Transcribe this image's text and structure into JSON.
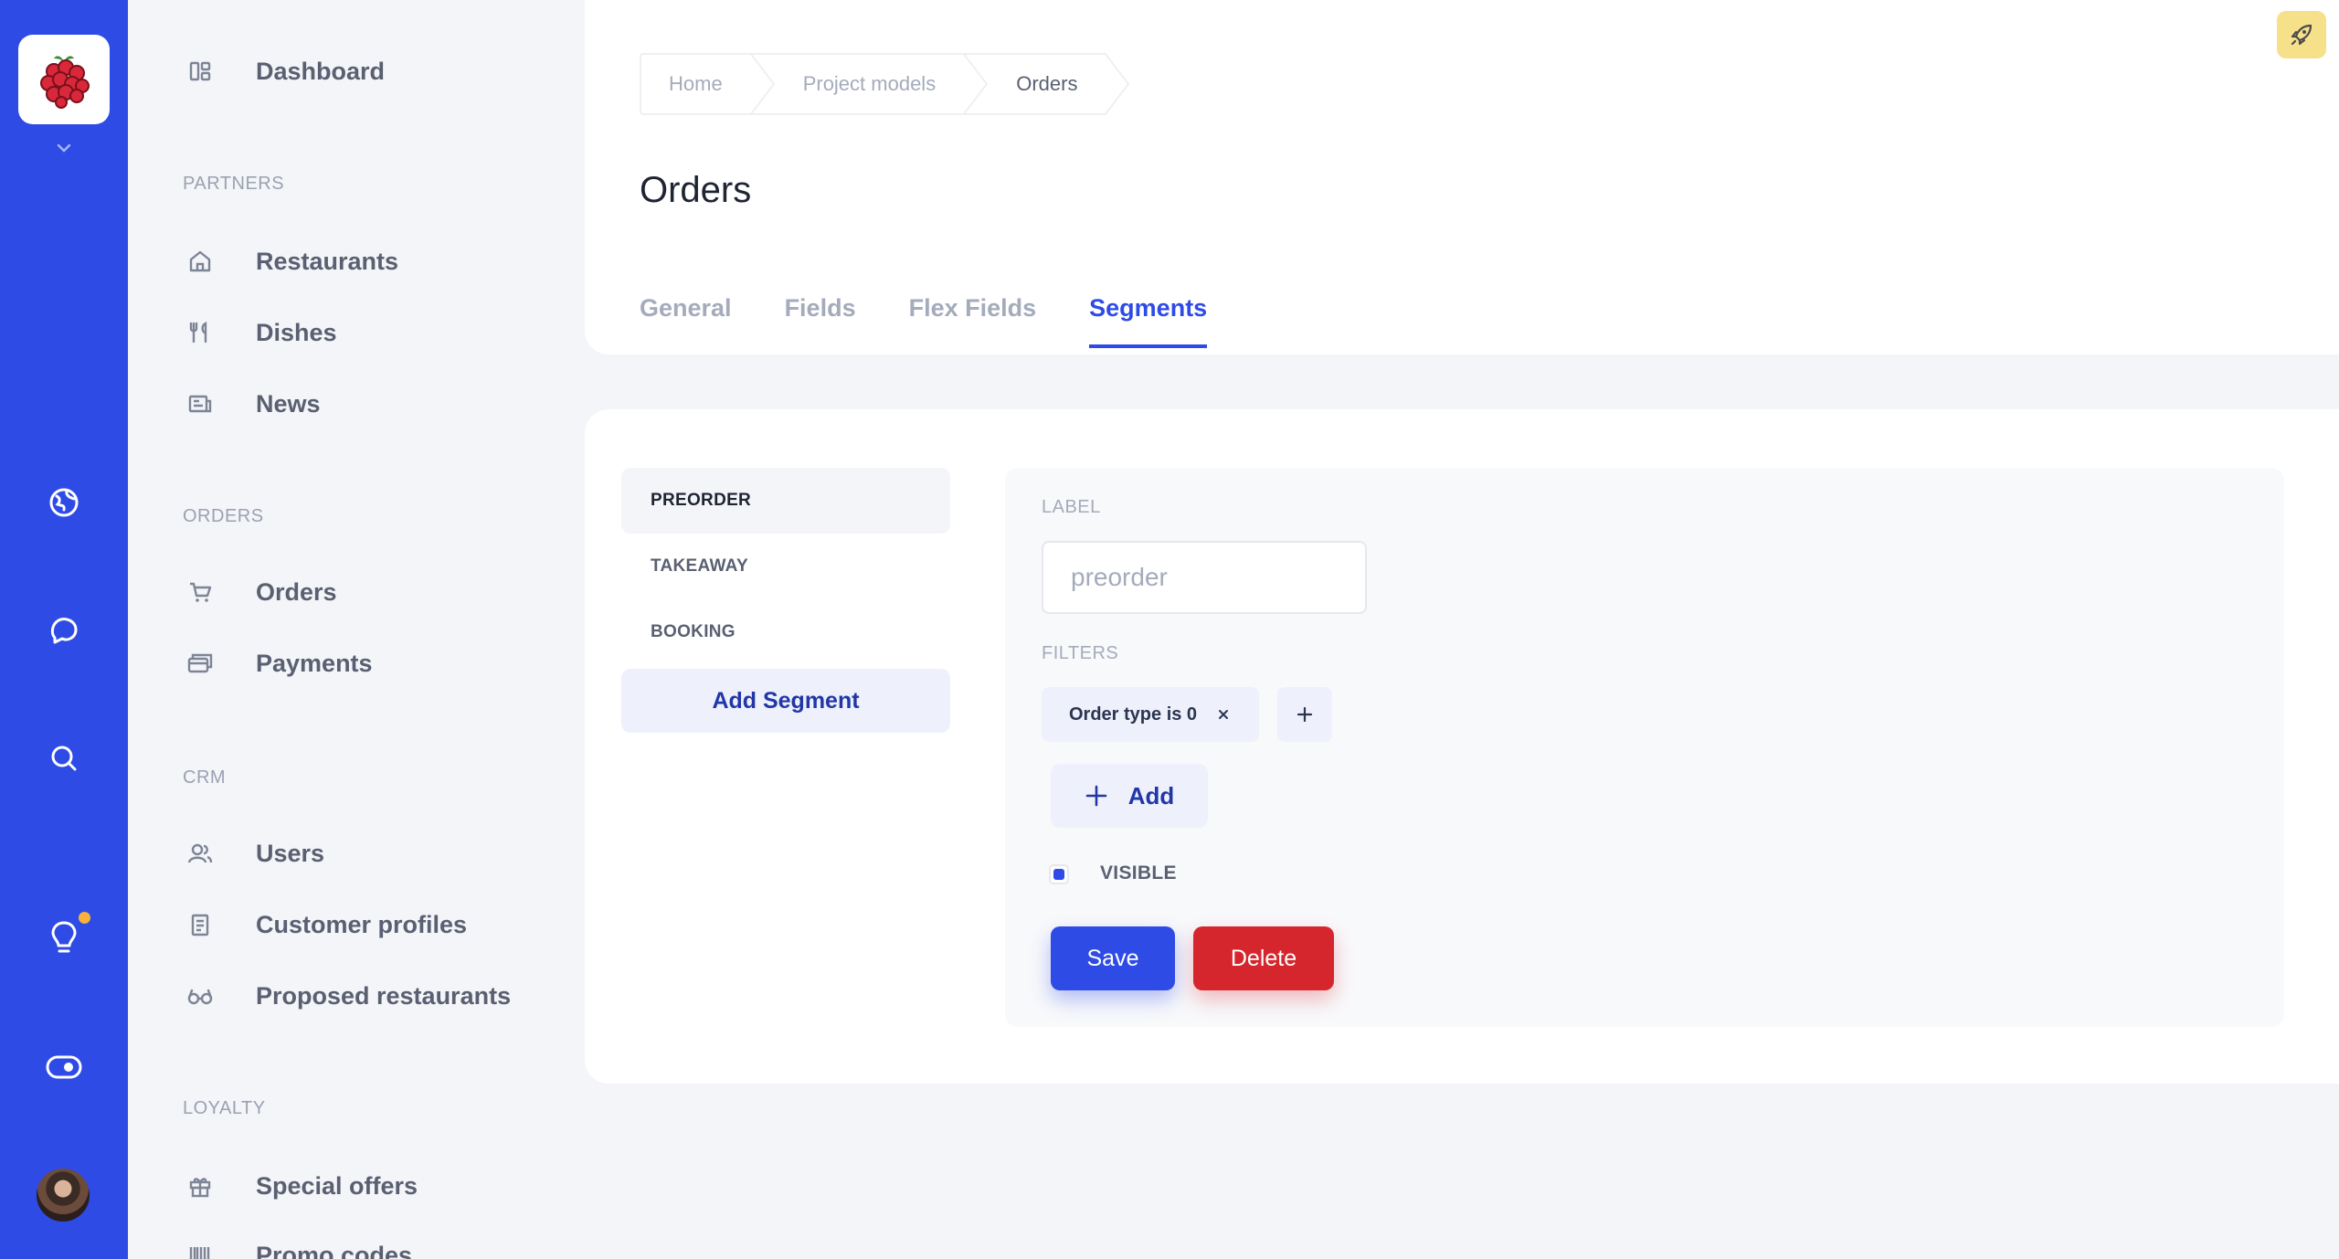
{
  "sidebar": {
    "sections": {
      "partners": "PARTNERS",
      "orders": "ORDERS",
      "crm": "CRM",
      "loyalty": "LOYALTY"
    },
    "items": {
      "dashboard": "Dashboard",
      "restaurants": "Restaurants",
      "dishes": "Dishes",
      "news": "News",
      "orders": "Orders",
      "payments": "Payments",
      "users": "Users",
      "customer_profiles": "Customer profiles",
      "proposed_restaurants": "Proposed restaurants",
      "special_offers": "Special offers",
      "promo_codes": "Promo codes"
    }
  },
  "breadcrumb": [
    "Home",
    "Project models",
    "Orders"
  ],
  "page_title": "Orders",
  "tabs": [
    "General",
    "Fields",
    "Flex Fields",
    "Segments"
  ],
  "active_tab": "Segments",
  "segments": {
    "items": [
      "PREORDER",
      "TAKEAWAY",
      "BOOKING"
    ],
    "active": "PREORDER",
    "add_label": "Add Segment"
  },
  "form": {
    "label_heading": "LABEL",
    "label_placeholder": "preorder",
    "filters_heading": "FILTERS",
    "filter_chip": "Order type is 0",
    "add_label": "Add",
    "visible_label": "VISIBLE",
    "visible_checked": true,
    "save_label": "Save",
    "delete_label": "Delete"
  },
  "colors": {
    "accent": "#2f4be6",
    "danger": "#d6262d",
    "notification_dot": "#f6b23b"
  }
}
